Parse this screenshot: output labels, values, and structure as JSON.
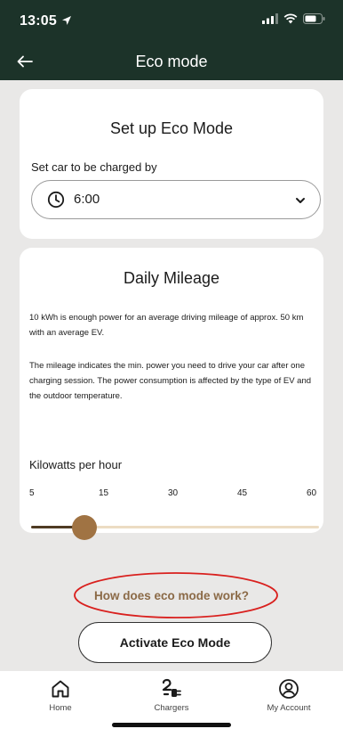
{
  "status_bar": {
    "time": "13:05"
  },
  "nav": {
    "title": "Eco mode"
  },
  "setup_card": {
    "title": "Set up Eco Mode",
    "charge_by_label": "Set car to be charged by",
    "charge_by_value": "6:00"
  },
  "mileage_card": {
    "title": "Daily Mileage",
    "paragraph1": "10 kWh is enough power for an average driving mileage of approx. 50 km with an average EV.",
    "paragraph2": "The mileage indicates the min. power you need to drive your car after one charging session. The power consumption is affected by the type of EV and the outdoor temperature.",
    "slider_label": "Kilowatts per hour",
    "ticks": [
      "5",
      "15",
      "30",
      "45",
      "60"
    ],
    "slider_value": 10,
    "slider_min": 5,
    "slider_max": 60
  },
  "help_link": "How does eco mode work?",
  "activate_button": "Activate Eco Mode",
  "tabs": [
    {
      "label": "Home",
      "icon": "home-icon"
    },
    {
      "label": "Chargers",
      "icon": "charger-plug-icon"
    },
    {
      "label": "My Account",
      "icon": "account-icon"
    }
  ],
  "colors": {
    "header_bg": "#1c3329",
    "accent_brown": "#a07343",
    "link_brown": "#8b6a47",
    "highlight_red": "#d9201e",
    "track_light": "#ecdcc3"
  }
}
